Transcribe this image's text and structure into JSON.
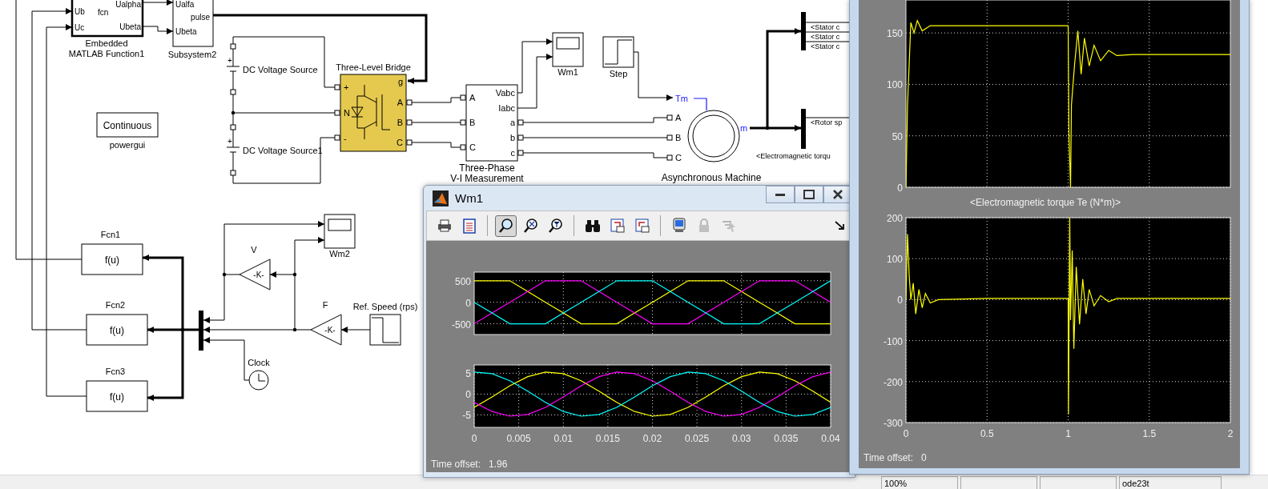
{
  "diagram": {
    "embedded_function": {
      "inputs": [
        "Ub",
        "Uc"
      ],
      "body": "fcn",
      "outputs": [
        "Ualpha",
        "Ubeta"
      ],
      "caption": [
        "Embedded",
        "MATLAB Function1"
      ]
    },
    "subsystem": {
      "inputs": [
        "Ualfa",
        "Ubeta"
      ],
      "outputs": [
        "pulse"
      ],
      "caption": "Subsystem2"
    },
    "dc_sources": [
      {
        "sign": "+",
        "label": "DC Voltage Source"
      },
      {
        "sign": "+",
        "label": "DC Voltage Source1"
      }
    ],
    "bridge": {
      "title": "Three-Level Bridge",
      "inputs": [
        "+",
        "N",
        "-"
      ],
      "gate": "g",
      "outputs": [
        "A",
        "B",
        "C"
      ]
    },
    "powergui": {
      "mode": "Continuous",
      "caption": "powergui"
    },
    "measurement": {
      "inputs": [
        "A",
        "B",
        "C"
      ],
      "outputs": [
        "Vabc",
        "Iabc",
        "a",
        "b",
        "c"
      ],
      "caption": [
        "Three-Phase",
        "V-I Measurement"
      ]
    },
    "scopes": [
      {
        "caption": "Wm1"
      },
      {
        "caption": "Wm2"
      }
    ],
    "steps": [
      {
        "caption": "Step"
      },
      {
        "caption": "Ref. Speed (rps)"
      }
    ],
    "machine": {
      "mech_input": "Tm",
      "inputs": [
        "A",
        "B",
        "C"
      ],
      "output": "m",
      "caption": "Asynchronous Machine"
    },
    "bus_selectors": [
      {
        "signals": [
          "<Stator c",
          "<Stator c",
          "<Stator c"
        ]
      },
      {
        "signals": [
          "<Rotor sp",
          "<Electromagnetic torqu"
        ]
      }
    ],
    "fcns": [
      {
        "caption": "Fcn1",
        "expr": "f(u)"
      },
      {
        "caption": "Fcn2",
        "expr": "f(u)"
      },
      {
        "caption": "Fcn3",
        "expr": "f(u)"
      }
    ],
    "gains": [
      {
        "caption": "V",
        "value": "-K-"
      },
      {
        "caption": "F",
        "value": "-K-"
      }
    ],
    "clock": {
      "caption": "Clock"
    }
  },
  "scope_windows": [
    {
      "title": "Wm1",
      "toolbar": [
        {
          "kind": "print",
          "selected": false,
          "disabled": false
        },
        {
          "kind": "parameters",
          "selected": false,
          "disabled": false
        },
        {
          "kind": "separator"
        },
        {
          "kind": "zoom",
          "selected": true,
          "disabled": false
        },
        {
          "kind": "zoom_x",
          "selected": false,
          "disabled": false
        },
        {
          "kind": "zoom_y",
          "selected": false,
          "disabled": false
        },
        {
          "kind": "separator"
        },
        {
          "kind": "autoscale",
          "selected": false,
          "disabled": false
        },
        {
          "kind": "save_axes",
          "selected": false,
          "disabled": false
        },
        {
          "kind": "restore_axes",
          "selected": false,
          "disabled": false
        },
        {
          "kind": "separator"
        },
        {
          "kind": "floating",
          "selected": false,
          "disabled": false
        },
        {
          "kind": "lock",
          "selected": false,
          "disabled": true
        },
        {
          "kind": "signal_select",
          "selected": false,
          "disabled": true
        },
        {
          "kind": "spacer"
        },
        {
          "kind": "dock",
          "selected": false,
          "disabled": false
        }
      ],
      "axes": [
        {
          "chart_data": {
            "type": "line",
            "grid": true,
            "x": [
              0,
              0.002,
              0.004,
              0.006,
              0.008,
              0.01,
              0.012,
              0.014,
              0.016,
              0.018,
              0.02,
              0.022,
              0.024,
              0.026,
              0.028,
              0.03,
              0.032,
              0.034,
              0.036,
              0.038,
              0.04
            ],
            "xlim": [
              0,
              0.04
            ],
            "ylim": [
              -750,
              700
            ],
            "yticks": [
              -500,
              0,
              500
            ],
            "series": [
              {
                "color": "#ffff00",
                "values": [
                  500,
                  500,
                  500,
                  250,
                  0,
                  -250,
                  -500,
                  -500,
                  -500,
                  -250,
                  0,
                  250,
                  500,
                  500,
                  500,
                  250,
                  0,
                  -250,
                  -500,
                  -500,
                  -500
                ]
              },
              {
                "color": "#ff00ff",
                "values": [
                  -500,
                  -250,
                  0,
                  250,
                  500,
                  500,
                  500,
                  250,
                  0,
                  -250,
                  -500,
                  -500,
                  -500,
                  -250,
                  0,
                  250,
                  500,
                  500,
                  500,
                  250,
                  0
                ]
              },
              {
                "color": "#00ffff",
                "values": [
                  0,
                  -250,
                  -500,
                  -500,
                  -500,
                  -250,
                  0,
                  250,
                  500,
                  500,
                  500,
                  250,
                  0,
                  -250,
                  -500,
                  -500,
                  -500,
                  -250,
                  0,
                  250,
                  500
                ]
              }
            ]
          }
        },
        {
          "chart_data": {
            "type": "line",
            "grid": true,
            "x": [
              0,
              0.002,
              0.004,
              0.006,
              0.008,
              0.01,
              0.012,
              0.014,
              0.016,
              0.018,
              0.02,
              0.022,
              0.024,
              0.026,
              0.028,
              0.03,
              0.032,
              0.034,
              0.036,
              0.038,
              0.04
            ],
            "xlim": [
              0,
              0.04
            ],
            "ylim": [
              -8,
              7
            ],
            "yticks": [
              -5,
              0,
              5
            ],
            "xticks": [
              0,
              0.005,
              0.01,
              0.015,
              0.02,
              0.025,
              0.03,
              0.035,
              0.04
            ],
            "series": [
              {
                "color": "#ffff00",
                "values": [
                  -3.2,
                  -0.7,
                  2.0,
                  4.2,
                  5.3,
                  4.9,
                  3.2,
                  0.7,
                  -2.0,
                  -4.2,
                  -5.3,
                  -4.9,
                  -3.2,
                  -0.7,
                  2.0,
                  4.2,
                  5.3,
                  4.9,
                  3.2,
                  0.7,
                  -2.0
                ]
              },
              {
                "color": "#ff00ff",
                "values": [
                  -2.0,
                  -4.2,
                  -5.3,
                  -4.9,
                  -3.2,
                  -0.7,
                  2.0,
                  4.2,
                  5.3,
                  4.9,
                  3.2,
                  0.7,
                  -2.0,
                  -4.2,
                  -5.3,
                  -4.9,
                  -3.2,
                  -0.7,
                  2.0,
                  4.2,
                  5.3
                ]
              },
              {
                "color": "#00ffff",
                "values": [
                  5.3,
                  4.9,
                  3.2,
                  0.7,
                  -2.0,
                  -4.2,
                  -5.3,
                  -4.9,
                  -3.2,
                  -0.7,
                  2.0,
                  4.2,
                  5.3,
                  4.9,
                  3.2,
                  0.7,
                  -2.0,
                  -4.2,
                  -5.3,
                  -4.9,
                  -3.2
                ]
              }
            ]
          }
        }
      ],
      "time_offset": {
        "label": "Time offset:",
        "value": "1.96"
      }
    },
    {
      "axes": [
        {
          "chart_data": {
            "type": "line",
            "grid": true,
            "x": [
              0,
              0.01,
              0.03,
              0.05,
              0.07,
              0.1,
              0.15,
              0.25,
              1.0,
              1.005,
              1.015,
              1.02,
              1.04,
              1.06,
              1.08,
              1.1,
              1.13,
              1.16,
              1.2,
              1.25,
              1.3,
              1.4,
              1.5,
              2
            ],
            "xlim": [
              0,
              2
            ],
            "ylim": [
              0,
              182
            ],
            "yticks": [
              0,
              50,
              100,
              150
            ],
            "series": [
              {
                "color": "#ffff00",
                "values": [
                  0,
                  80,
                  160,
                  150,
                  162,
                  152,
                  157,
                  157,
                  157,
                  50,
                  0,
                  80,
                  120,
                  152,
                  110,
                  145,
                  118,
                  138,
                  123,
                  133,
                  128,
                  129,
                  129,
                  129
                ]
              }
            ]
          }
        },
        {
          "chart_data": {
            "type": "line",
            "grid": true,
            "title": "<Electromagnetic torque Te (N*m)>",
            "x": [
              0,
              0.01,
              0.02,
              0.03,
              0.045,
              0.06,
              0.08,
              0.1,
              0.12,
              0.15,
              0.2,
              0.5,
              1.0,
              1.002,
              1.01,
              1.015,
              1.025,
              1.035,
              1.05,
              1.07,
              1.09,
              1.11,
              1.13,
              1.16,
              1.2,
              1.25,
              1.3,
              1.4,
              2
            ],
            "xlim": [
              0,
              2
            ],
            "ylim": [
              -300,
              200
            ],
            "yticks": [
              -300,
              -200,
              -100,
              0,
              100,
              200
            ],
            "xticks": [
              0,
              0.5,
              1,
              1.5,
              2
            ],
            "series": [
              {
                "color": "#ffff00",
                "values": [
                  0,
                  160,
                  60,
                  0,
                  40,
                  -35,
                  25,
                  -20,
                  15,
                  -8,
                  0,
                  3,
                  3,
                  -280,
                  200,
                  -50,
                  120,
                  -120,
                  80,
                  -60,
                  50,
                  -35,
                  25,
                  -15,
                  10,
                  -5,
                  3,
                  3,
                  3
                ]
              }
            ]
          }
        }
      ],
      "time_offset": {
        "label": "Time offset:",
        "value": "0"
      }
    }
  ],
  "status_bar": {
    "zoom": "100%",
    "solver": "ode23t"
  }
}
